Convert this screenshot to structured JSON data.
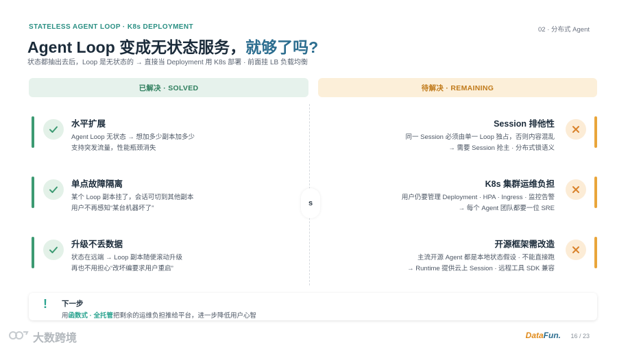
{
  "header": {
    "eyebrow": "STATELESS AGENT LOOP · K8s DEPLOYMENT",
    "section_tag": "02 · 分布式 Agent",
    "title_main": "Agent Loop 变成无状态服务，",
    "title_accent": "就够了吗?",
    "subtitle": "状态都抽出去后，Loop 是无状态的 → 直接当 Deployment 用 K8s 部署 · 前面挂 LB 负载均衡"
  },
  "columns": {
    "solved_label": "已解决 · SOLVED",
    "remaining_label": "待解决 · REMAINING"
  },
  "separator_letter": "s",
  "solved": [
    {
      "title": "水平扩展",
      "line1": "Agent Loop 无状态 → 想加多少副本加多少",
      "line2": "支持突发流量，性能瓶颈消失",
      "icon": "check-icon"
    },
    {
      "title": "单点故障隔离",
      "line1": "某个 Loop 副本挂了，会话可切到其他副本",
      "line2": "用户不再感知“某台机器坏了”",
      "icon": "check-icon"
    },
    {
      "title": "升级不丢数据",
      "line1": "状态在远端 → Loop 副本随便滚动升级",
      "line2": "再也不用担心“改坏编要求用户重启”",
      "icon": "check-icon"
    }
  ],
  "remaining": [
    {
      "title": "Session 排他性",
      "line1": "同一 Session 必须由单一 Loop 独占，否则内容混乱",
      "line2": "→ 需要 Session 抢主 · 分布式锁语义",
      "icon": "cross-icon"
    },
    {
      "title": "K8s 集群运维负担",
      "line1": "用户仍要管理 Deployment · HPA · Ingress · 监控告警",
      "line2": "→ 每个 Agent 团队都要一位 SRE",
      "icon": "cross-icon"
    },
    {
      "title": "开源框架需改造",
      "line1": "主流开源 Agent 都是本地状态假设 · 不能直接跑",
      "line2": "→ Runtime 提供云上 Session · 远程工具 SDK 兼容",
      "icon": "cross-icon"
    }
  ],
  "footer": {
    "bang": "!",
    "title": "下一步",
    "prefix": "用",
    "highlight": "函数式 · 全托管",
    "suffix": "把剩余的运维负担推给平台，进一步降低用户心智"
  },
  "watermark": {
    "text": "大数跨境"
  },
  "brand": {
    "part1": "Data",
    "part2": "Fun."
  },
  "page": "16 / 23",
  "colors": {
    "solved_accent": "#3c9a72",
    "remaining_accent": "#e9a53a",
    "title_accent": "#2b6d8f",
    "highlight": "#2aa38f"
  }
}
